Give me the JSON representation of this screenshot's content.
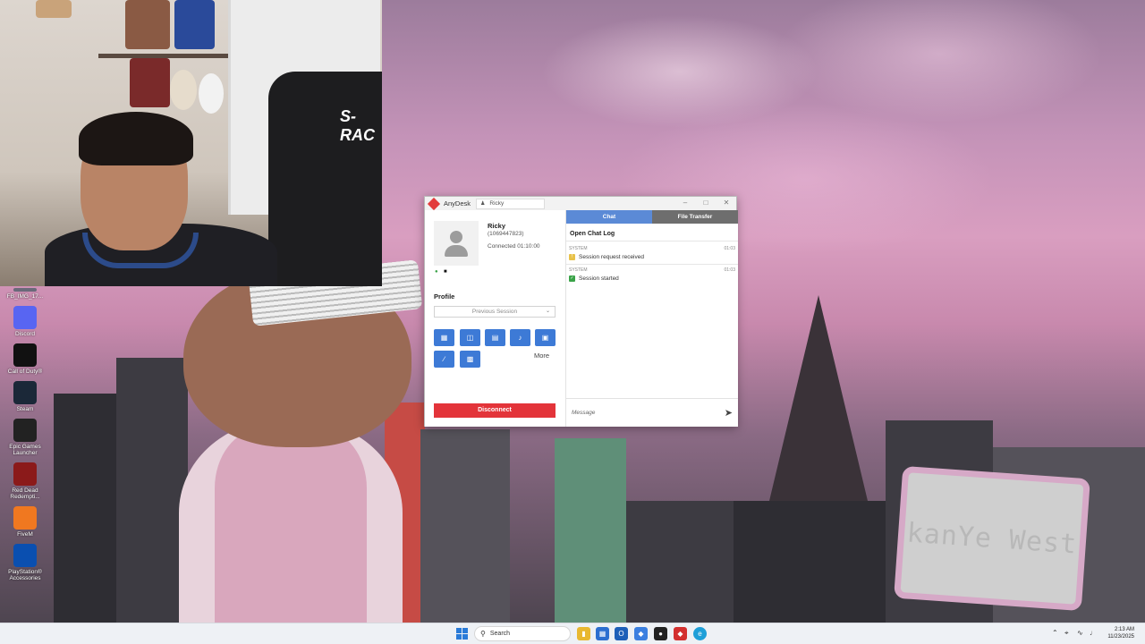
{
  "desktop": {
    "sign_text": "kanYe West",
    "icons": [
      {
        "label": "FB_IMG_17...",
        "icon": "image-icon",
        "color": "#6a6a7a"
      },
      {
        "label": "Discord",
        "icon": "discord-icon",
        "color": "#5865f2"
      },
      {
        "label": "Call of Duty®",
        "icon": "call-of-duty-icon",
        "color": "#111111"
      },
      {
        "label": "Steam",
        "icon": "steam-icon",
        "color": "#1b2838"
      },
      {
        "label": "Epic Games Launcher",
        "icon": "epic-games-icon",
        "color": "#222222"
      },
      {
        "label": "Red Dead Redempti...",
        "icon": "red-dead-icon",
        "color": "#8b1a1a"
      },
      {
        "label": "FiveM",
        "icon": "fivem-icon",
        "color": "#f07820"
      },
      {
        "label": "PlayStation® Accessories",
        "icon": "playstation-icon",
        "color": "#0a4fb0"
      }
    ]
  },
  "webcam": {
    "chair_brand": "S-RAC"
  },
  "anydesk": {
    "app_title": "AnyDesk",
    "tab_label": "Ricky",
    "peer": {
      "name": "Ricky",
      "id": "(1069447823)",
      "connected": "Connected 01:10:00"
    },
    "profile": {
      "heading": "Profile",
      "select_value": "Previous Session"
    },
    "toolbar": {
      "more_label": "More"
    },
    "disconnect_label": "Disconnect",
    "tabs": [
      {
        "label": "Chat",
        "active": true
      },
      {
        "label": "File Transfer",
        "active": false
      }
    ],
    "chat": {
      "log_title": "Open Chat Log",
      "messages": [
        {
          "sender": "SYSTEM",
          "time": "01:03",
          "text": "Session request received",
          "icon_color": "#e8c24a"
        },
        {
          "sender": "SYSTEM",
          "time": "01:03",
          "text": "Session started",
          "icon_color": "#3aa348"
        }
      ],
      "input_placeholder": "Message"
    },
    "accent_color": "#e23b3b"
  },
  "taskbar": {
    "search_label": "Search",
    "clock": {
      "time": "2:13 AM",
      "date": "11/23/2025"
    }
  }
}
